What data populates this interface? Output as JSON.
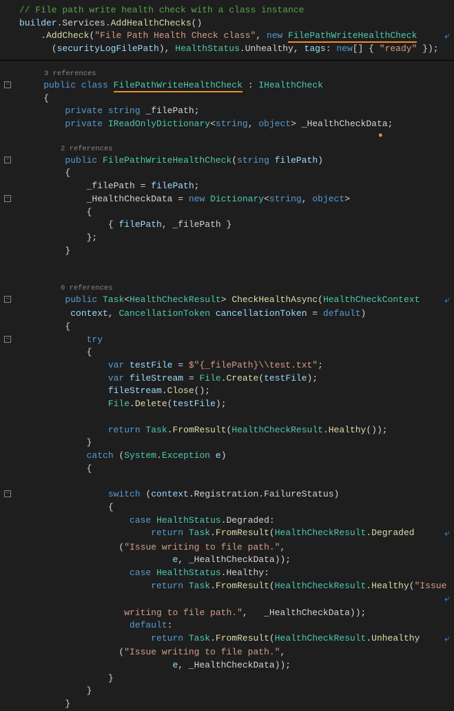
{
  "topPanel": {
    "comment": "// File path write health check with a class instance",
    "builder": "builder",
    "services": ".Services.",
    "addHC": "AddHealthChecks",
    "addCheck": "AddCheck",
    "checkName": "\"File Path Health Check class\"",
    "newKw": "new",
    "hcType": "FilePathWriteHealthCheck",
    "securityPath": "securityLogFilePath",
    "healthStatus": "HealthStatus",
    "unhealthy": ".Unhealthy",
    "tagsLabel": "tags",
    "newArr": "new",
    "readyStr": "\"ready\""
  },
  "refs3": "3 references",
  "refs2": "2 references",
  "refs0": "0 references",
  "kw": {
    "public": "public",
    "class": "class",
    "private": "private",
    "string": "string",
    "object": "object",
    "new": "new",
    "return": "return",
    "try": "try",
    "catch": "catch",
    "var": "var",
    "switch": "switch",
    "case": "case",
    "default": "default"
  },
  "types": {
    "FilePathWriteHealthCheck": "FilePathWriteHealthCheck",
    "IHealthCheck": "IHealthCheck",
    "IReadOnlyDictionary": "IReadOnlyDictionary",
    "Dictionary": "Dictionary",
    "Task": "Task",
    "HealthCheckResult": "HealthCheckResult",
    "HealthCheckContext": "HealthCheckContext",
    "CancellationToken": "CancellationToken",
    "File": "File",
    "System": "System",
    "Exception": "Exception",
    "HealthStatus": "HealthStatus"
  },
  "fields": {
    "filePath": "_filePath",
    "hcData": "_HealthCheckData",
    "filePathParam": "filePath",
    "context": "context",
    "cancellationToken": "cancellationToken",
    "defaultKw": "default",
    "testFile": "testFile",
    "fileStream": "fileStream",
    "e": "e"
  },
  "strings": {
    "testTxt": "$\"{_filePath}\\\\test.txt\"",
    "issueMsg": "\"Issue writing to file path.\"",
    "issueMsg2": "\"Issue writing to file path.\"",
    "issueInline": "\"Issue"
  },
  "methods": {
    "CheckHealthAsync": "CheckHealthAsync",
    "Create": "Create",
    "Close": "Close",
    "Delete": "Delete",
    "FromResult": "FromResult",
    "Healthy": "Healthy",
    "Degraded": "Degraded",
    "Unhealthy": "Unhealthy",
    "Registration": "Registration",
    "FailureStatus": "FailureStatus"
  },
  "labels": {
    "healthyCase": "Healthy",
    "degradedCase": "Degraded",
    "writingInline": " writing to file path.\""
  }
}
